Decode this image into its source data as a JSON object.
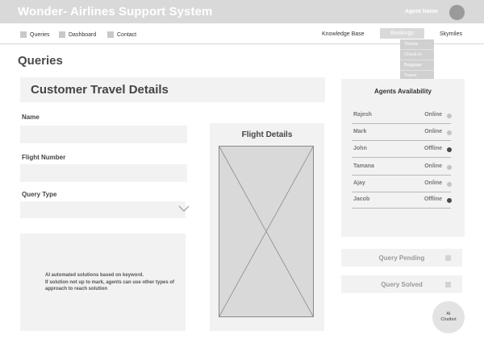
{
  "header": {
    "title": "Wonder- Airlines Support System",
    "agent_name": "Agent Name"
  },
  "nav": {
    "left": [
      "Queries",
      "Dashboard",
      "Contact"
    ],
    "knowledge_base": "Knowledge Base",
    "bookings": "Bookings",
    "skymiles": "Skymiles",
    "bookings_menu": [
      "Tickets",
      "Check-in",
      "Baggage",
      "Travel"
    ]
  },
  "page": {
    "title": "Queries"
  },
  "customer_details": {
    "title": "Customer Travel Details",
    "name_label": "Name",
    "flight_number_label": "Flight Number",
    "query_type_label": "Query Type",
    "name_value": "",
    "flight_number_value": "",
    "query_type_value": "",
    "ai_note_line1": "AI automated solutions based on keyword.",
    "ai_note_line2": "If solution not up to mark, agents can use other types of approach to reach solution"
  },
  "flight_details": {
    "title": "Flight Details"
  },
  "agents": {
    "title": "Agents Availability",
    "list": [
      {
        "name": "Rajesh",
        "status": "Online",
        "color": "#c4c4c4"
      },
      {
        "name": "Mark",
        "status": "Online",
        "color": "#c4c4c4"
      },
      {
        "name": "John",
        "status": "Offline",
        "color": "#4a4a4a"
      },
      {
        "name": "Tamana",
        "status": "Online",
        "color": "#c4c4c4"
      },
      {
        "name": "Ajay",
        "status": "Online",
        "color": "#c4c4c4"
      },
      {
        "name": "Jacob",
        "status": "Offline",
        "color": "#4a4a4a"
      }
    ]
  },
  "queries": {
    "pending_label": "Query Pending",
    "solved_label": "Query Solved"
  },
  "chatbot": {
    "line1": "AI",
    "line2": "Chatbot"
  },
  "colors": {
    "header_bg": "#d9d9d9",
    "panel_bg": "#f2f2f2",
    "online_dot": "#c4c4c4",
    "offline_dot": "#4a4a4a"
  }
}
